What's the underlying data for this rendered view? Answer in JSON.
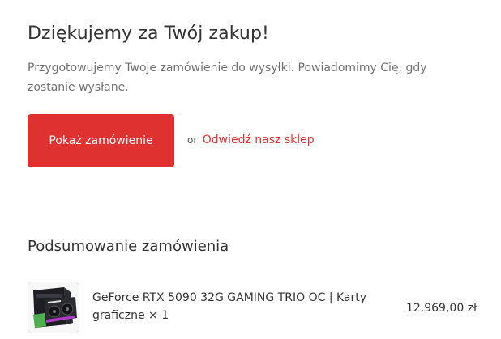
{
  "confirmation": {
    "heading": "Dziękujemy za Twój zakup!",
    "message": "Przygotowujemy Twoje zamówienie do wysyłki. Powiadomimy Cię, gdy zostanie wysłane."
  },
  "actions": {
    "show_order_label": "Pokaż zamówienie",
    "or_text": "or",
    "visit_shop_label": "Odwiedź nasz sklep"
  },
  "summary": {
    "title": "Podsumowanie zamówienia",
    "items": [
      {
        "name": "GeForce RTX 5090 32G GAMING TRIO OC | Karty graficzne",
        "quantity_text": "× 1",
        "price": "12.969,00 zł",
        "image_icon": "graphics-card-icon"
      }
    ]
  },
  "colors": {
    "accent": "#e03131",
    "text": "#333333",
    "muted_text": "#707070"
  }
}
